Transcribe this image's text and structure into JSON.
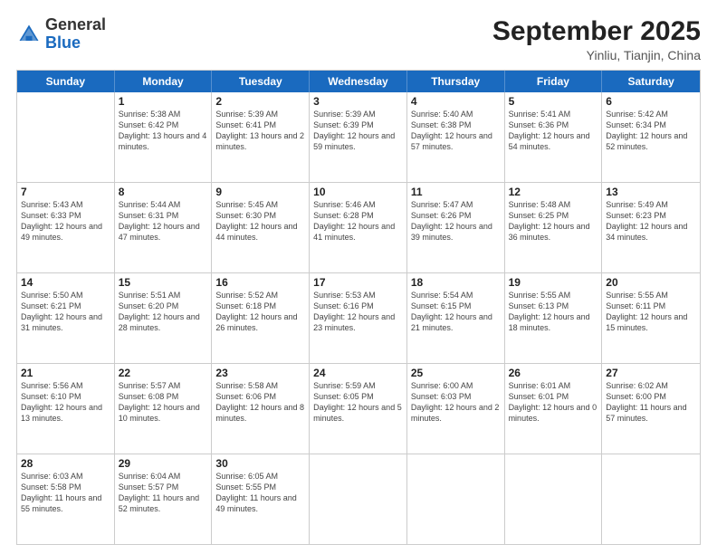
{
  "header": {
    "logo_general": "General",
    "logo_blue": "Blue",
    "month_title": "September 2025",
    "location": "Yinliu, Tianjin, China"
  },
  "weekdays": [
    "Sunday",
    "Monday",
    "Tuesday",
    "Wednesday",
    "Thursday",
    "Friday",
    "Saturday"
  ],
  "rows": [
    [
      {
        "day": "",
        "sunrise": "",
        "sunset": "",
        "daylight": ""
      },
      {
        "day": "1",
        "sunrise": "Sunrise: 5:38 AM",
        "sunset": "Sunset: 6:42 PM",
        "daylight": "Daylight: 13 hours and 4 minutes."
      },
      {
        "day": "2",
        "sunrise": "Sunrise: 5:39 AM",
        "sunset": "Sunset: 6:41 PM",
        "daylight": "Daylight: 13 hours and 2 minutes."
      },
      {
        "day": "3",
        "sunrise": "Sunrise: 5:39 AM",
        "sunset": "Sunset: 6:39 PM",
        "daylight": "Daylight: 12 hours and 59 minutes."
      },
      {
        "day": "4",
        "sunrise": "Sunrise: 5:40 AM",
        "sunset": "Sunset: 6:38 PM",
        "daylight": "Daylight: 12 hours and 57 minutes."
      },
      {
        "day": "5",
        "sunrise": "Sunrise: 5:41 AM",
        "sunset": "Sunset: 6:36 PM",
        "daylight": "Daylight: 12 hours and 54 minutes."
      },
      {
        "day": "6",
        "sunrise": "Sunrise: 5:42 AM",
        "sunset": "Sunset: 6:34 PM",
        "daylight": "Daylight: 12 hours and 52 minutes."
      }
    ],
    [
      {
        "day": "7",
        "sunrise": "Sunrise: 5:43 AM",
        "sunset": "Sunset: 6:33 PM",
        "daylight": "Daylight: 12 hours and 49 minutes."
      },
      {
        "day": "8",
        "sunrise": "Sunrise: 5:44 AM",
        "sunset": "Sunset: 6:31 PM",
        "daylight": "Daylight: 12 hours and 47 minutes."
      },
      {
        "day": "9",
        "sunrise": "Sunrise: 5:45 AM",
        "sunset": "Sunset: 6:30 PM",
        "daylight": "Daylight: 12 hours and 44 minutes."
      },
      {
        "day": "10",
        "sunrise": "Sunrise: 5:46 AM",
        "sunset": "Sunset: 6:28 PM",
        "daylight": "Daylight: 12 hours and 41 minutes."
      },
      {
        "day": "11",
        "sunrise": "Sunrise: 5:47 AM",
        "sunset": "Sunset: 6:26 PM",
        "daylight": "Daylight: 12 hours and 39 minutes."
      },
      {
        "day": "12",
        "sunrise": "Sunrise: 5:48 AM",
        "sunset": "Sunset: 6:25 PM",
        "daylight": "Daylight: 12 hours and 36 minutes."
      },
      {
        "day": "13",
        "sunrise": "Sunrise: 5:49 AM",
        "sunset": "Sunset: 6:23 PM",
        "daylight": "Daylight: 12 hours and 34 minutes."
      }
    ],
    [
      {
        "day": "14",
        "sunrise": "Sunrise: 5:50 AM",
        "sunset": "Sunset: 6:21 PM",
        "daylight": "Daylight: 12 hours and 31 minutes."
      },
      {
        "day": "15",
        "sunrise": "Sunrise: 5:51 AM",
        "sunset": "Sunset: 6:20 PM",
        "daylight": "Daylight: 12 hours and 28 minutes."
      },
      {
        "day": "16",
        "sunrise": "Sunrise: 5:52 AM",
        "sunset": "Sunset: 6:18 PM",
        "daylight": "Daylight: 12 hours and 26 minutes."
      },
      {
        "day": "17",
        "sunrise": "Sunrise: 5:53 AM",
        "sunset": "Sunset: 6:16 PM",
        "daylight": "Daylight: 12 hours and 23 minutes."
      },
      {
        "day": "18",
        "sunrise": "Sunrise: 5:54 AM",
        "sunset": "Sunset: 6:15 PM",
        "daylight": "Daylight: 12 hours and 21 minutes."
      },
      {
        "day": "19",
        "sunrise": "Sunrise: 5:55 AM",
        "sunset": "Sunset: 6:13 PM",
        "daylight": "Daylight: 12 hours and 18 minutes."
      },
      {
        "day": "20",
        "sunrise": "Sunrise: 5:55 AM",
        "sunset": "Sunset: 6:11 PM",
        "daylight": "Daylight: 12 hours and 15 minutes."
      }
    ],
    [
      {
        "day": "21",
        "sunrise": "Sunrise: 5:56 AM",
        "sunset": "Sunset: 6:10 PM",
        "daylight": "Daylight: 12 hours and 13 minutes."
      },
      {
        "day": "22",
        "sunrise": "Sunrise: 5:57 AM",
        "sunset": "Sunset: 6:08 PM",
        "daylight": "Daylight: 12 hours and 10 minutes."
      },
      {
        "day": "23",
        "sunrise": "Sunrise: 5:58 AM",
        "sunset": "Sunset: 6:06 PM",
        "daylight": "Daylight: 12 hours and 8 minutes."
      },
      {
        "day": "24",
        "sunrise": "Sunrise: 5:59 AM",
        "sunset": "Sunset: 6:05 PM",
        "daylight": "Daylight: 12 hours and 5 minutes."
      },
      {
        "day": "25",
        "sunrise": "Sunrise: 6:00 AM",
        "sunset": "Sunset: 6:03 PM",
        "daylight": "Daylight: 12 hours and 2 minutes."
      },
      {
        "day": "26",
        "sunrise": "Sunrise: 6:01 AM",
        "sunset": "Sunset: 6:01 PM",
        "daylight": "Daylight: 12 hours and 0 minutes."
      },
      {
        "day": "27",
        "sunrise": "Sunrise: 6:02 AM",
        "sunset": "Sunset: 6:00 PM",
        "daylight": "Daylight: 11 hours and 57 minutes."
      }
    ],
    [
      {
        "day": "28",
        "sunrise": "Sunrise: 6:03 AM",
        "sunset": "Sunset: 5:58 PM",
        "daylight": "Daylight: 11 hours and 55 minutes."
      },
      {
        "day": "29",
        "sunrise": "Sunrise: 6:04 AM",
        "sunset": "Sunset: 5:57 PM",
        "daylight": "Daylight: 11 hours and 52 minutes."
      },
      {
        "day": "30",
        "sunrise": "Sunrise: 6:05 AM",
        "sunset": "Sunset: 5:55 PM",
        "daylight": "Daylight: 11 hours and 49 minutes."
      },
      {
        "day": "",
        "sunrise": "",
        "sunset": "",
        "daylight": ""
      },
      {
        "day": "",
        "sunrise": "",
        "sunset": "",
        "daylight": ""
      },
      {
        "day": "",
        "sunrise": "",
        "sunset": "",
        "daylight": ""
      },
      {
        "day": "",
        "sunrise": "",
        "sunset": "",
        "daylight": ""
      }
    ]
  ]
}
